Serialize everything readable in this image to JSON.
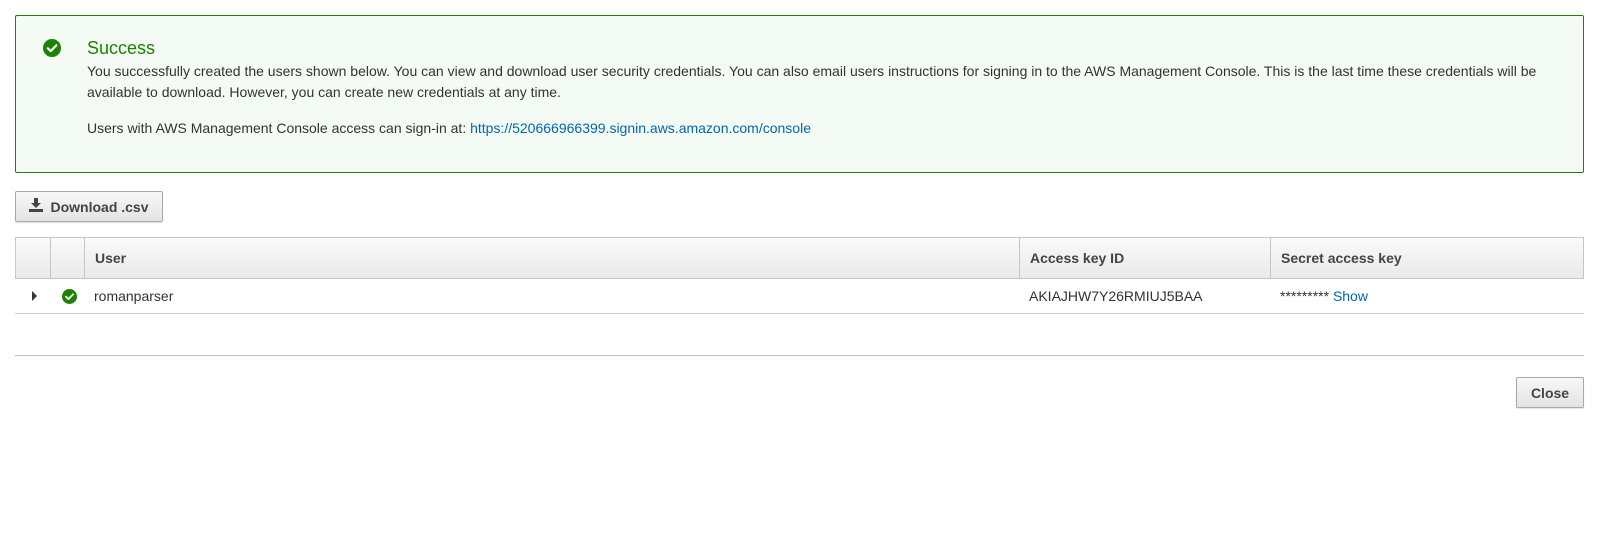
{
  "alert": {
    "title": "Success",
    "message": "You successfully created the users shown below. You can view and download user security credentials. You can also email users instructions for signing in to the AWS Management Console. This is the last time these credentials will be available to download. However, you can create new credentials at any time.",
    "signin_prefix": "Users with AWS Management Console access can sign-in at: ",
    "signin_url": "https://520666966399.signin.aws.amazon.com/console",
    "icon": "check-circle-icon",
    "color": "#1d8102"
  },
  "toolbar": {
    "download_label": "Download .csv",
    "download_icon": "download-icon"
  },
  "table": {
    "headers": [
      "",
      "",
      "User",
      "Access key ID",
      "Secret access key"
    ],
    "rows": [
      {
        "status_icon": "check-circle-icon",
        "user": "romanparser",
        "access_key_id": "AKIAJHW7Y26RMIUJ5BAA",
        "secret_masked": "*********",
        "secret_show_label": "Show"
      }
    ]
  },
  "footer": {
    "close_label": "Close"
  },
  "colors": {
    "success": "#1d8102",
    "link": "#0066b3"
  }
}
